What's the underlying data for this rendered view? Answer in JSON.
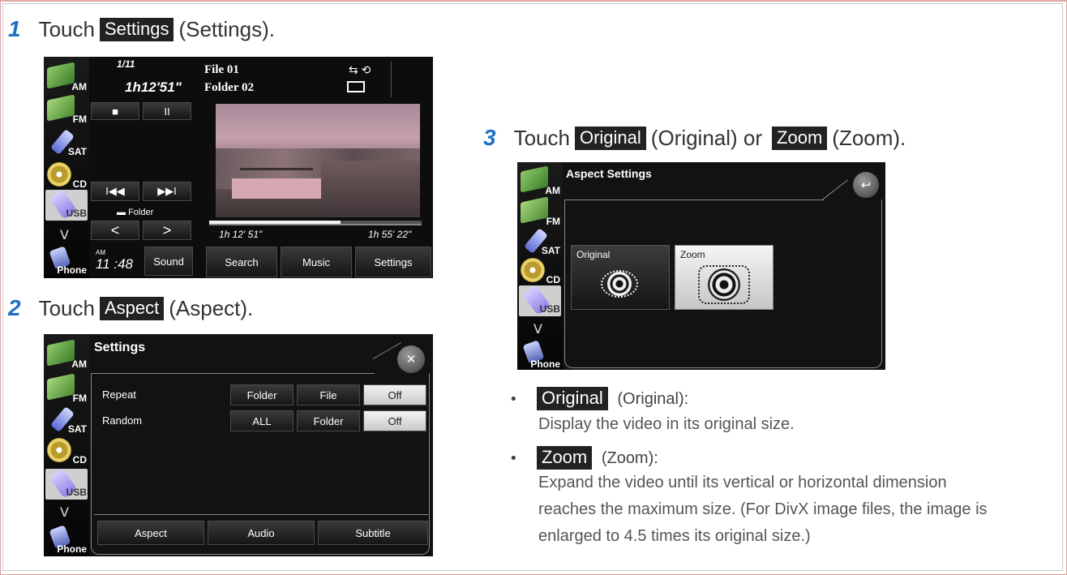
{
  "steps": [
    {
      "num": "1",
      "pre": "Touch",
      "button": "Settings",
      "post": "(Settings)."
    },
    {
      "num": "2",
      "pre": "Touch",
      "button": "Aspect",
      "post": "(Aspect)."
    },
    {
      "num": "3",
      "pre": "Touch",
      "button": "Original",
      "mid": "(Original) or",
      "button2": "Zoom",
      "post": "(Zoom)."
    }
  ],
  "sidebar": [
    "AM",
    "FM",
    "SAT",
    "CD",
    "USB",
    "V",
    "Phone"
  ],
  "player": {
    "track": "1/11",
    "elapsed_big": "1h12'51\"",
    "file": "File 01",
    "folder": "Folder 02",
    "stop": "■",
    "pause": "II",
    "prev": "I◀◀",
    "next": "▶▶I",
    "folder_label": "Folder",
    "left_arrow": "<",
    "right_arrow": ">",
    "ampm": "AM",
    "clock": "11 :48",
    "sound": "Sound",
    "time_current": "1h 12' 51\"",
    "time_total": "1h 55' 22\"",
    "progress": 0.62,
    "search": "Search",
    "music": "Music",
    "settings": "Settings"
  },
  "settings_screen": {
    "title": "Settings",
    "repeat_label": "Repeat",
    "repeat_options": [
      "Folder",
      "File",
      "Off"
    ],
    "random_label": "Random",
    "random_options": [
      "ALL",
      "Folder",
      "Off"
    ],
    "aspect": "Aspect",
    "audio": "Audio",
    "subtitle": "Subtitle",
    "close": "✕"
  },
  "aspect_screen": {
    "title": "Aspect Settings",
    "original": "Original",
    "zoom": "Zoom",
    "back": "↩"
  },
  "notes": {
    "original_button": "Original",
    "original_suffix": "(Original):",
    "original_desc": "Display the video in its original size.",
    "zoom_button": "Zoom",
    "zoom_suffix": "(Zoom):",
    "zoom_desc_1": "Expand the video until its vertical or horizontal dimension",
    "zoom_desc_2": "reaches the maximum size. (For DivX image files, the image is",
    "zoom_desc_3": "enlarged to 4.5 times its original size.)"
  }
}
